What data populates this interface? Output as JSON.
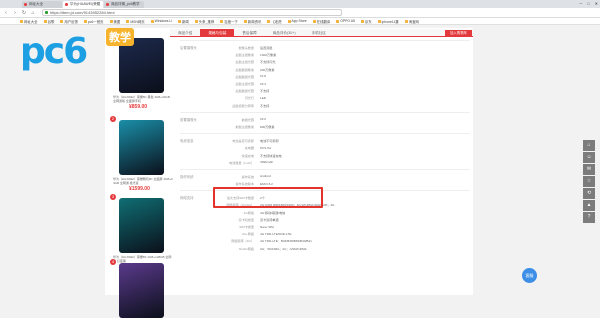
{
  "browser": {
    "tabs": [
      {
        "label": "网址大全",
        "active": false
      },
      {
        "label": "华为(HUAWEI)荣耀",
        "active": true
      },
      {
        "label": "商品详情_pc6教学",
        "active": false
      }
    ],
    "window_buttons": [
      "─",
      "□",
      "✕"
    ],
    "url": "https://item.jd.com/9143952284.html",
    "bookmarks": [
      "网址大全",
      "谷歌",
      "用户反馈",
      "pc6一首页",
      "美图",
      "MSN网页",
      "Windows Li",
      "新闻",
      "头条_推荐",
      "百度一下",
      "新闻资讯",
      "【老虎",
      "App Store",
      "在线翻译",
      "OPPO A5",
      "京东",
      "iphone11集",
      "淘宝网"
    ]
  },
  "logo": {
    "text": "pc6",
    "badge": "教学"
  },
  "products": [
    {
      "num": "",
      "title": "华为（HUAWEI）荣耀8C 黑色 4GB+32GB 全网通版 全面屏手机",
      "price": "¥859.00",
      "sales": "",
      "color": "#1d2a4d"
    },
    {
      "num": "2",
      "title": "华为（HUAWEI）荣耀畅玩8C 全面屏 4GB+64GB 全网通 极光蓝",
      "price": "¥1599.00",
      "sales": "",
      "color": "#1a8fa8"
    },
    {
      "num": "3",
      "title": "华为（HUAWEI）荣耀8X 4GB+128GB 全网通 幻夜黑",
      "price": "¥1599.00",
      "sales": "",
      "color": "#0f6f74"
    },
    {
      "num": "4",
      "title": "",
      "price": "",
      "sales": "",
      "color": "#5a3a8c"
    }
  ],
  "product_tabs": [
    "商品介绍",
    "规格与包装",
    "售后保障",
    "商品评价(30+)",
    "手机社区"
  ],
  "active_tab": "规格与包装",
  "cart_button": "加入购物车",
  "spec_groups": [
    {
      "title": "后置摄像头",
      "rows": [
        {
          "k": "摄像头数量",
          "v": "后置双摄"
        },
        {
          "k": "后摄主摄像素",
          "v": "1300万像素"
        },
        {
          "k": "后摄主摄光圈",
          "v": "不支持闪光"
        },
        {
          "k": "后摄副摄像素",
          "v": "200万像素"
        },
        {
          "k": "后摄副摄光圈",
          "v": "f/1.8"
        },
        {
          "k": "后摄主摄光圈",
          "v": "f/2.4"
        },
        {
          "k": "后摄副摄光圈",
          "v": "不支持"
        },
        {
          "k": "闪光灯",
          "v": "LED"
        },
        {
          "k": "后摄视频分辨率",
          "v": "不支持"
        }
      ]
    },
    {
      "title": "前置摄像头",
      "rows": [
        {
          "k": "前摄光圈",
          "v": "f/2.0"
        },
        {
          "k": "前摄主摄像素",
          "v": "800万像素"
        }
      ]
    },
    {
      "title": "电池信息",
      "rows": [
        {
          "k": "电池是否可拆卸",
          "v": "电池不可拆卸"
        },
        {
          "k": "充电器",
          "v": "5V/1.5A"
        },
        {
          "k": "快速充电",
          "v": "不支持快速充电"
        },
        {
          "k": "电池容量（mAh）",
          "v": "3990mAh"
        }
      ]
    },
    {
      "title": "操作系统",
      "rows": [
        {
          "k": "操作系统",
          "v": "Android"
        },
        {
          "k": "操作系统版本",
          "v": "EMUI 8.2"
        }
      ]
    },
    {
      "title": "网络支持",
      "rows": [
        {
          "k": "最大支持SIM卡数量",
          "v": "2个"
        },
        {
          "k": "网络频率（2G/3G）",
          "v": "2G:GSM 900/1800/1900；3G:WCDMA 900/2100；4G"
        },
        {
          "k": "4G网络",
          "v": "4G:移动/联通/电信"
        },
        {
          "k": "双卡机类型",
          "v": "双卡双待单通"
        },
        {
          "k": "SIM卡类型",
          "v": "Nano SIM"
        },
        {
          "k": "4G+网络",
          "v": "4G TDD-LTE/FDD-LTE"
        },
        {
          "k": "网络频率（4G）",
          "v": "4G TDD-LTE：B34/B38/B39/B40/B41"
        },
        {
          "k": "3G/2G网络",
          "v": "3G：WCDMA；2G：GSM/CDMA"
        }
      ]
    }
  ],
  "right_tools": [
    "⌂",
    "☺",
    "✉",
    "☆",
    "⟲",
    "▲",
    "?"
  ],
  "chat_bubble": "客服"
}
